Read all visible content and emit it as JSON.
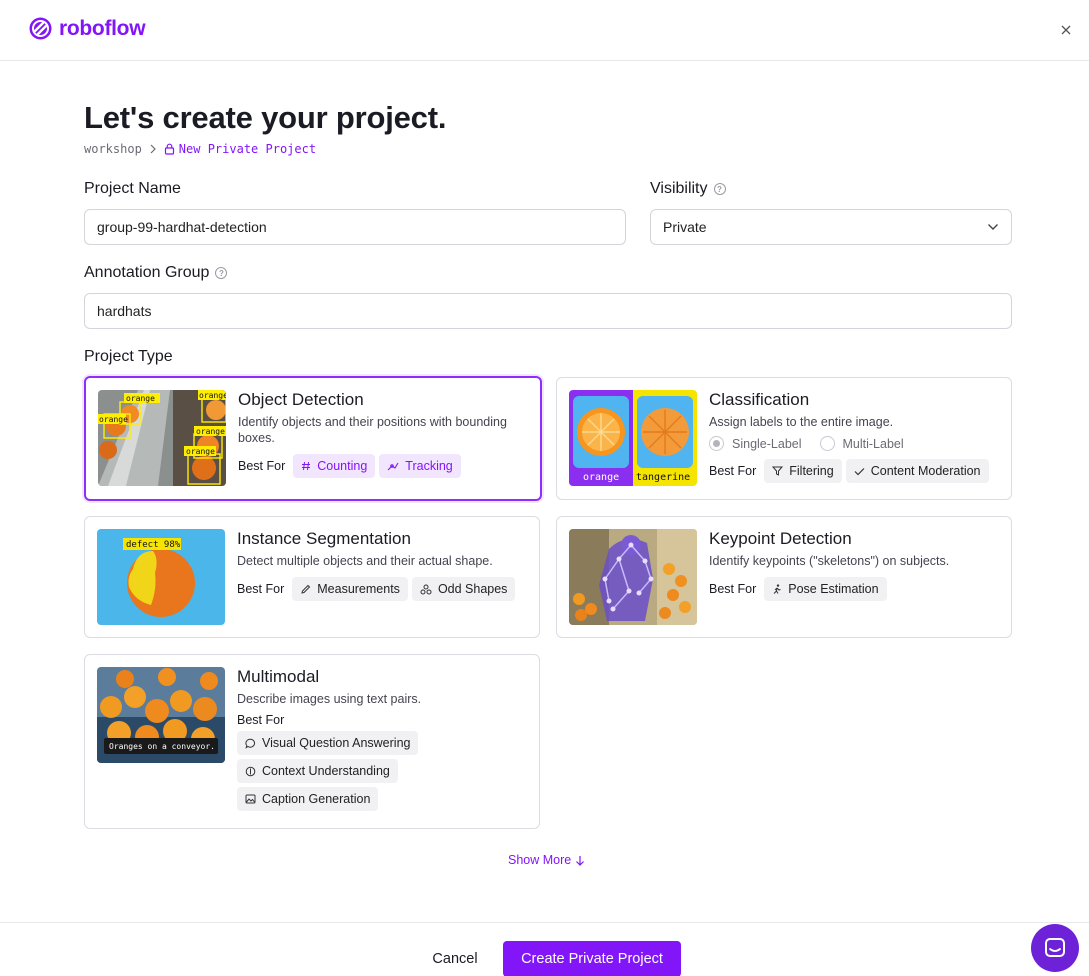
{
  "brand": {
    "name": "roboflow",
    "color": "#8315f9"
  },
  "page": {
    "title": "Let's create your project.",
    "breadcrumb": {
      "workspace": "workshop",
      "separator": ">",
      "current": "New Private Project"
    }
  },
  "form": {
    "project_name": {
      "label": "Project Name",
      "value": "group-99-hardhat-detection"
    },
    "visibility": {
      "label": "Visibility",
      "value": "Private",
      "help_icon": "help-circle-icon"
    },
    "annotation_group": {
      "label": "Annotation Group",
      "value": "hardhats",
      "help_icon": "help-circle-icon"
    },
    "project_type_label": "Project Type"
  },
  "project_types": {
    "object_detection": {
      "title": "Object Detection",
      "description": "Identify objects and their positions with bounding boxes.",
      "best_for": "Best For",
      "tags": [
        "Counting",
        "Tracking"
      ],
      "thumb_labels": [
        "orange",
        "orange",
        "orange",
        "orange",
        "orange"
      ],
      "selected": true
    },
    "classification": {
      "title": "Classification",
      "description": "Assign labels to the entire image.",
      "radio": [
        "Single-Label",
        "Multi-Label"
      ],
      "best_for": "Best For",
      "tags": [
        "Filtering",
        "Content Moderation"
      ],
      "thumb_labels": [
        "orange",
        "tangerine"
      ]
    },
    "instance_segmentation": {
      "title": "Instance Segmentation",
      "description": "Detect multiple objects and their actual shape.",
      "best_for": "Best For",
      "tags": [
        "Measurements",
        "Odd Shapes"
      ],
      "thumb_label": "defect 98%"
    },
    "keypoint_detection": {
      "title": "Keypoint Detection",
      "description": "Identify keypoints (\"skeletons\") on subjects.",
      "best_for": "Best For",
      "tags": [
        "Pose Estimation"
      ]
    },
    "multimodal": {
      "title": "Multimodal",
      "description": "Describe images using text pairs.",
      "best_for": "Best For",
      "tags": [
        "Visual Question Answering",
        "Context Understanding",
        "Caption Generation"
      ],
      "thumb_caption": "Oranges on a conveyor."
    }
  },
  "show_more": "Show More",
  "footer": {
    "cancel": "Cancel",
    "create": "Create Private Project"
  },
  "colors": {
    "accent": "#8315f9",
    "selected_border": "#8f2ef8",
    "tag_purple_bg": "#f2e6fe"
  }
}
